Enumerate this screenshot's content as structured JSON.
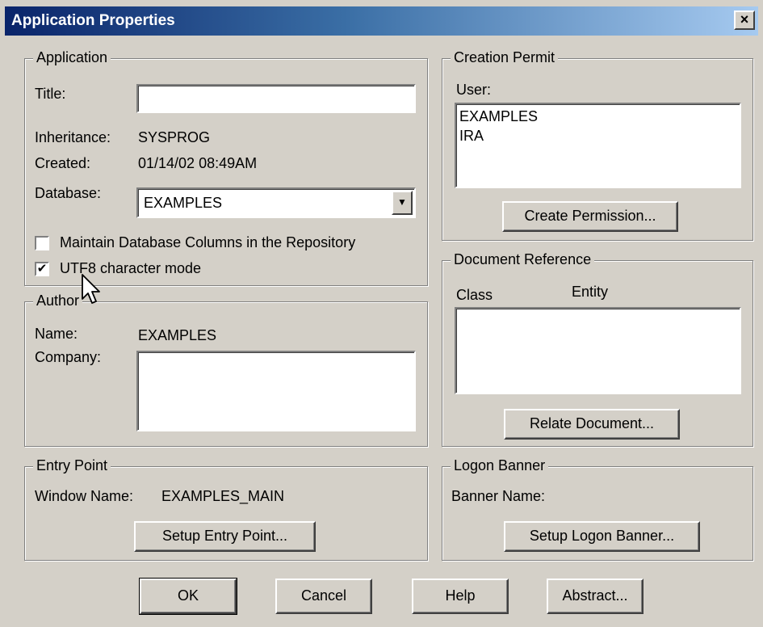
{
  "window": {
    "title": "Application Properties",
    "close": "×"
  },
  "application": {
    "legend": "Application",
    "title_label": "Title:",
    "title_value": "",
    "inheritance_label": "Inheritance:",
    "inheritance_value": "SYSPROG",
    "created_label": "Created:",
    "created_value": "01/14/02 08:49AM",
    "database_label": "Database:",
    "database_value": "EXAMPLES",
    "maintain_label": "Maintain Database Columns in the Repository",
    "maintain_checked": false,
    "utf8_label": "UTF8 character mode",
    "utf8_checked": true,
    "check_glyph": "✔"
  },
  "author": {
    "legend": "Author",
    "name_label": "Name:",
    "name_value": "EXAMPLES",
    "company_label": "Company:",
    "company_value": ""
  },
  "entry_point": {
    "legend": "Entry Point",
    "window_name_label": "Window Name:",
    "window_name_value": "EXAMPLES_MAIN",
    "setup_button": "Setup Entry Point..."
  },
  "creation_permit": {
    "legend": "Creation Permit",
    "user_label": "User:",
    "users": [
      "EXAMPLES",
      "IRA"
    ],
    "create_button": "Create Permission..."
  },
  "document_reference": {
    "legend": "Document Reference",
    "class_label": "Class",
    "entity_label": "Entity",
    "relate_button": "Relate Document..."
  },
  "logon_banner": {
    "legend": "Logon Banner",
    "banner_name_label": "Banner Name:",
    "banner_name_value": "",
    "setup_button": "Setup Logon Banner..."
  },
  "buttons": {
    "ok": "OK",
    "cancel": "Cancel",
    "help": "Help",
    "abstract": "Abstract..."
  }
}
